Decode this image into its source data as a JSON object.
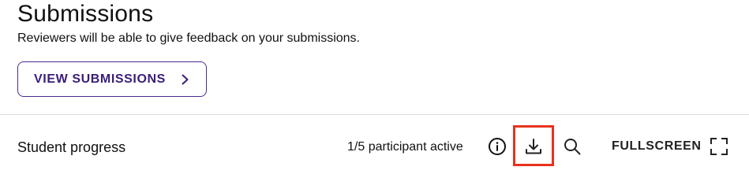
{
  "submissions": {
    "title": "Submissions",
    "subtitle": "Reviewers will be able to give feedback on your submissions.",
    "view_button_label": "VIEW SUBMISSIONS",
    "accent_color": "#3a1d7a"
  },
  "progress": {
    "label": "Student progress",
    "participants_text": "1/5 participant active",
    "fullscreen_label": "FULLSCREEN",
    "highlight_color": "#e8321c"
  },
  "icons": {
    "chevron": "chevron-right-icon",
    "info": "info-icon",
    "download": "download-icon",
    "search": "search-icon",
    "fullscreen": "fullscreen-icon"
  }
}
